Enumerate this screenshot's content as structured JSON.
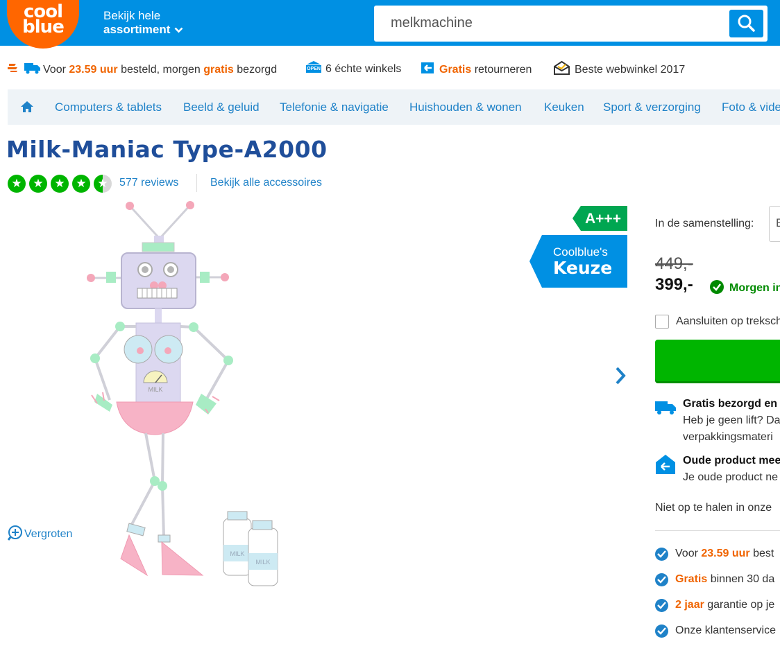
{
  "header": {
    "logo_line1": "cool",
    "logo_line2": "blue",
    "assortiment_line1": "Bekijk hele",
    "assortiment_line2": "assortiment",
    "search_value": "melkmachine"
  },
  "usp_bar": {
    "item1_pre": "Voor ",
    "item1_time": "23.59 uur",
    "item1_mid": " besteld, morgen ",
    "item1_gratis": "gratis",
    "item1_post": " bezorgd",
    "item2": "6 échte winkels",
    "item2_icon_text": "OPEN",
    "item3_gratis": "Gratis",
    "item3_post": " retourneren",
    "item4": "Beste webwinkel 2017"
  },
  "nav": {
    "items": [
      "Computers & tablets",
      "Beeld & geluid",
      "Telefonie & navigatie",
      "Huishouden & wonen",
      "Keuken",
      "Sport & verzorging",
      "Foto & video"
    ]
  },
  "product": {
    "title": "Milk-Maniac Type-A2000",
    "rating": 4.5,
    "reviews": "577 reviews",
    "accessories": "Bekijk alle accessoires",
    "zoom": "Vergroten",
    "energy_label": "A+++",
    "keuze_line1": "Coolblue's",
    "keuze_line2": "Keuze",
    "image_text": "MILK"
  },
  "buy": {
    "config_label": "In de samenstelling:",
    "config_value": "B",
    "old_price": "449,-",
    "price": "399,-",
    "delivery": "Morgen in huis",
    "checkbox_label": "Aansluiten op treksch",
    "feature1_title": "Gratis bezorgd en",
    "feature1_line1": "Heb je geen lift? Da",
    "feature1_line2": "verpakkingsmateri",
    "feature2_title": "Oude product mee",
    "feature2_line1": "Je oude product ne",
    "pickup": "Niet op te halen in onze",
    "check1_pre": "Voor ",
    "check1_hl": "23.59 uur",
    "check1_post": " best",
    "check2_hl": "Gratis",
    "check2_post": " binnen 30 da",
    "check3_hl": "2 jaar",
    "check3_post": " garantie op je",
    "check4": "Onze klantenservice"
  },
  "colors": {
    "brand_blue": "#0090e3",
    "brand_orange": "#ff6600",
    "link_blue": "#1f82c8",
    "title_blue": "#1f4e9a",
    "green": "#00b500"
  }
}
